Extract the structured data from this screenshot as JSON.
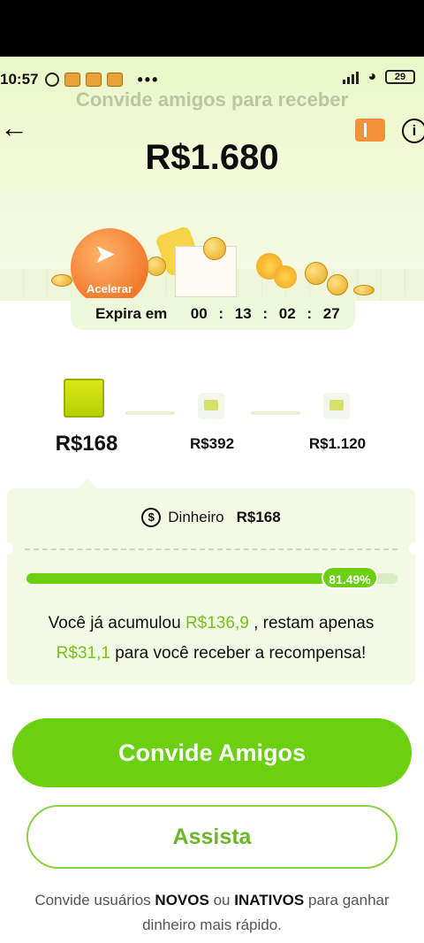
{
  "status_bar": {
    "time": "10:57",
    "more": "•••",
    "battery": "29"
  },
  "header": {
    "subtitle": "Convide amigos para receber",
    "amount": "R$1.680"
  },
  "accelerate": {
    "label": "Acelerar"
  },
  "expiry": {
    "label": "Expira em",
    "hours": "00",
    "minutes": "13",
    "seconds": "02",
    "frames": "27"
  },
  "milestones": [
    {
      "label": "R$168",
      "active": true
    },
    {
      "label": "R$392",
      "active": false
    },
    {
      "label": "R$1.120",
      "active": false
    }
  ],
  "reward_card": {
    "cash_label": "Dinheiro",
    "cash_value": "R$168",
    "progress_percent": 81.49,
    "progress_label": "81.49%",
    "msg_part1": "Você já acumulou",
    "accumulated": "R$136,9",
    "msg_part2": ", restam apenas",
    "remaining": "R$31,1",
    "msg_part3": "para você receber a recompensa!"
  },
  "buttons": {
    "invite": "Convide Amigos",
    "watch": "Assista"
  },
  "footer": {
    "part1": "Convide usuários",
    "novos": "NOVOS",
    "part2": "ou",
    "inativos": "INATIVOS",
    "part3": "para ganhar dinheiro mais rápido."
  },
  "colors": {
    "accent": "#6ad010",
    "accent_text": "#77c31b",
    "accelerate": "#f27a2a"
  }
}
